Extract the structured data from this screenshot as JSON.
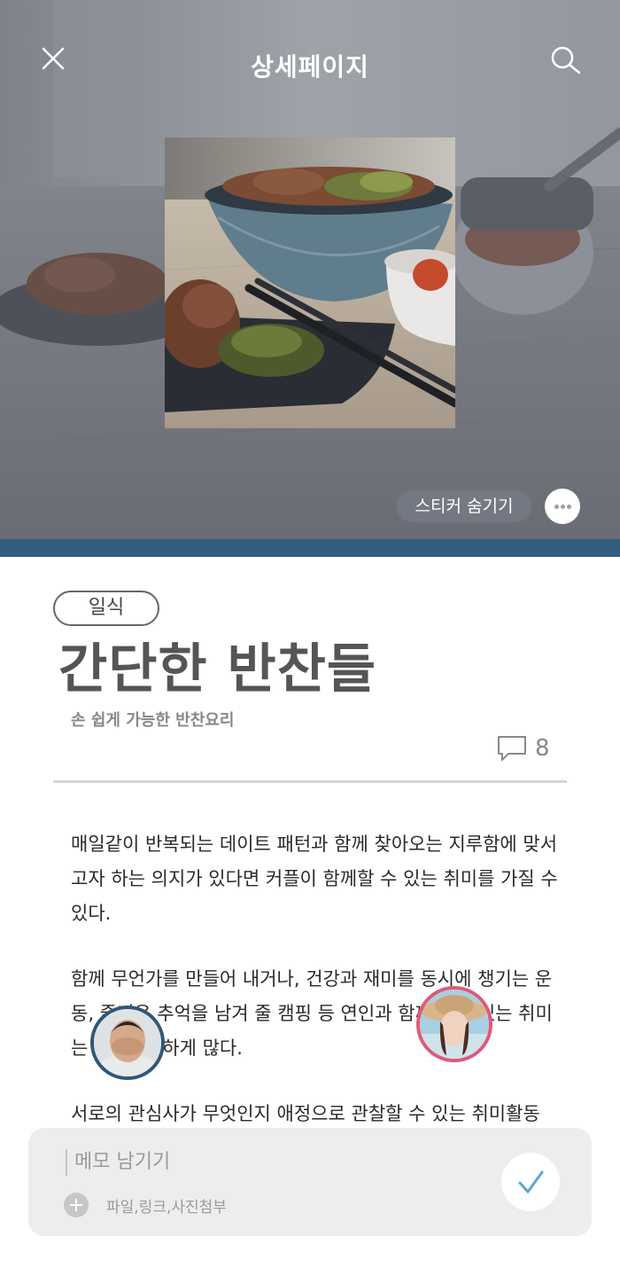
{
  "header": {
    "title": "상세페이지",
    "close_icon": "close-icon",
    "search_icon": "search-icon"
  },
  "hero": {
    "sticker_toggle_label": "스티커 숨기기",
    "more_icon": "more-dots-icon",
    "bar_color": "#335d7e"
  },
  "post": {
    "category": "일식",
    "title": "간단한 반찬들",
    "subtitle": "손 쉽게 가능한 반찬요리",
    "comment_icon": "speech-bubble-icon",
    "comment_count": "8",
    "paragraphs": [
      "매일같이 반복되는 데이트 패턴과 함께 찾아오는 지루함에 맞서고자 하는 의지가 있다면 커플이 함께할 수 있는 취미를 가질 수 있다.",
      "함께 무언가를 만들어 내거나, 건강과 재미를 동시에 챙기는 운동, 즐거운 추억을 남겨 줄 캠핑 등 연인과 함께할 수 있는 취미는 무궁무진하게 많다.",
      "서로의 관심사가 무엇인지 애정으로 관찰할 수 있는 취미활동"
    ]
  },
  "avatars": {
    "left_border_color": "#2f5777",
    "right_border_color": "#e05978"
  },
  "memo": {
    "placeholder": "메모 남기기",
    "attach_label": "파일,링크,사진첨부",
    "attach_icon": "plus-circle-icon",
    "submit_icon": "check-icon",
    "check_color": "#5aa6d8"
  }
}
